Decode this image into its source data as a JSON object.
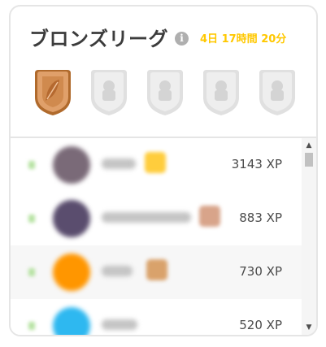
{
  "league": {
    "title": "ブロンズリーグ",
    "timer": "4日 17時間 20分",
    "info_icon": "info-icon",
    "accent_color": "#ffc800"
  },
  "badges": [
    {
      "name": "bronze",
      "state": "active",
      "icon": "feather-icon",
      "color": "#cd8a4a"
    },
    {
      "name": "locked-2",
      "state": "locked",
      "icon": "lock-icon",
      "color": "#e5e5e5"
    },
    {
      "name": "locked-3",
      "state": "locked",
      "icon": "lock-icon",
      "color": "#e5e5e5"
    },
    {
      "name": "locked-4",
      "state": "locked",
      "icon": "lock-icon",
      "color": "#e5e5e5"
    },
    {
      "name": "locked-5",
      "state": "locked",
      "icon": "lock-icon",
      "color": "#e5e5e5"
    }
  ],
  "leaderboard": [
    {
      "xp": "3143 XP",
      "avatar_color": "#7a6a78",
      "flair_color": "#ffcd3c",
      "highlight": false
    },
    {
      "xp": "883 XP",
      "avatar_color": "#5a4d6e",
      "flair_color": "#d8a48a",
      "highlight": false
    },
    {
      "xp": "730 XP",
      "avatar_color": "#ff9600",
      "flair_color": "#d9a26b",
      "highlight": true
    },
    {
      "xp": "520 XP",
      "avatar_color": "#2eb8f0",
      "flair_color": "",
      "highlight": false
    }
  ]
}
